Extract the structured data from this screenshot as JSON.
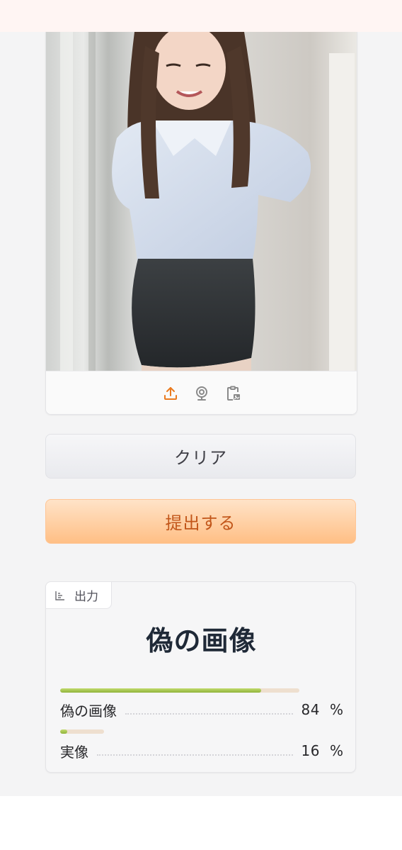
{
  "image_input": {
    "source_buttons": [
      {
        "icon": "upload-icon",
        "color": "#ea7a1e"
      },
      {
        "icon": "webcam-icon",
        "color": "#8a8a8a"
      },
      {
        "icon": "clipboard-icon",
        "color": "#8a8a8a"
      }
    ]
  },
  "buttons": {
    "clear_label": "クリア",
    "submit_label": "提出する"
  },
  "output": {
    "tag_label": "出力",
    "tag_icon": "chart-icon",
    "result_label": "偽の画像",
    "confidences": [
      {
        "label": "偽の画像",
        "value": "84",
        "unit": "%",
        "fraction": 0.84
      },
      {
        "label": "実像",
        "value": "16",
        "unit": "%",
        "fraction": 0.16
      }
    ]
  },
  "colors": {
    "accent": "#ea7a1e",
    "submit_text": "#c2561a",
    "bar_fill": "#8fb33a",
    "bar_track": "#eedfcf"
  }
}
